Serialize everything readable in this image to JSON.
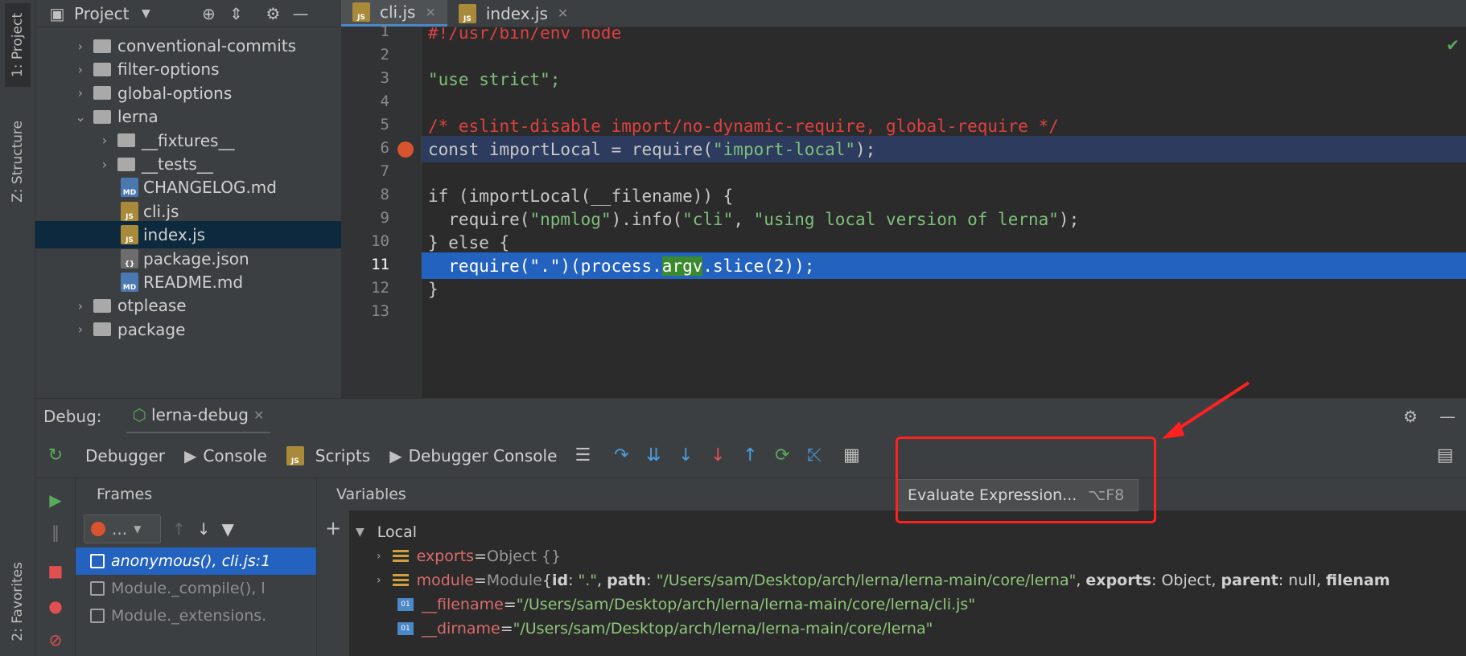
{
  "left_strip": {
    "project_tab": "1: Project",
    "structure_tab": "Z: Structure",
    "favorites_tab": "2: Favorites"
  },
  "project_panel": {
    "title": "Project",
    "tree": [
      {
        "label": "conventional-commits",
        "type": "folder",
        "expanded": false,
        "indent": 1
      },
      {
        "label": "filter-options",
        "type": "folder",
        "expanded": false,
        "indent": 1
      },
      {
        "label": "global-options",
        "type": "folder",
        "expanded": false,
        "indent": 1
      },
      {
        "label": "lerna",
        "type": "folder",
        "expanded": true,
        "indent": 1
      },
      {
        "label": "__fixtures__",
        "type": "folder",
        "expanded": false,
        "indent": 2
      },
      {
        "label": "__tests__",
        "type": "folder",
        "expanded": false,
        "indent": 2
      },
      {
        "label": "CHANGELOG.md",
        "type": "md",
        "indent": 2
      },
      {
        "label": "cli.js",
        "type": "js",
        "indent": 2
      },
      {
        "label": "index.js",
        "type": "js",
        "indent": 2,
        "selected": true
      },
      {
        "label": "package.json",
        "type": "json",
        "indent": 2
      },
      {
        "label": "README.md",
        "type": "md",
        "indent": 2
      },
      {
        "label": "otplease",
        "type": "folder",
        "expanded": false,
        "indent": 1
      },
      {
        "label": "package",
        "type": "folder",
        "expanded": false,
        "indent": 1
      }
    ]
  },
  "editor": {
    "tabs": [
      {
        "label": "cli.js",
        "active": true
      },
      {
        "label": "index.js",
        "active": false
      }
    ],
    "line_numbers": [
      "1",
      "2",
      "3",
      "4",
      "5",
      "6",
      "7",
      "8",
      "9",
      "10",
      "11",
      "12",
      "13"
    ],
    "lines": {
      "l1": "#!/usr/bin/env node",
      "l3": "\"use strict\";",
      "l5": "/* eslint-disable import/no-dynamic-require, global-require */",
      "l6_a": "const importLocal = require(",
      "l6_b": "\"import-local\"",
      "l6_c": ");",
      "l8": "if (importLocal(__filename)) {",
      "l9_a": "  require(",
      "l9_b": "\"npmlog\"",
      "l9_c": ").info(",
      "l9_d": "\"cli\"",
      "l9_e": ", ",
      "l9_f": "\"using local version of lerna\"",
      "l9_g": ");",
      "l10": "} else {",
      "l11_a": "  require(\".\")(process.",
      "l11_b": "argv",
      "l11_c": ".slice(2));",
      "l12": "}"
    }
  },
  "debug": {
    "label": "Debug:",
    "config": "lerna-debug",
    "tabs": {
      "debugger": "Debugger",
      "console": "Console",
      "scripts": "Scripts",
      "debugger_console": "Debugger Console"
    },
    "frames_header": "Frames",
    "variables_header": "Variables",
    "thread_selector": "...",
    "frames": [
      {
        "label": "anonymous(), cli.js:1",
        "selected": true
      },
      {
        "label": "Module._compile(), l",
        "selected": false
      },
      {
        "label": "Module._extensions.",
        "selected": false
      }
    ],
    "variables": {
      "local_label": "Local",
      "exports_name": "exports",
      "exports_eq": " = ",
      "exports_val": "Object {}",
      "module_name": "module",
      "module_eq": " = ",
      "module_type": "Module ",
      "module_brace": "{",
      "module_id_key": "id",
      "module_id_val": "\".\"",
      "module_path_key": "path",
      "module_path_val": "\"/Users/sam/Desktop/arch/lerna/lerna-main/core/lerna\"",
      "module_exports_key": "exports",
      "module_exports_val": "Object",
      "module_parent_key": "parent",
      "module_parent_val": "null",
      "module_tail": "filenam",
      "filename_name": "__filename",
      "filename_eq": " = ",
      "filename_val": "\"/Users/sam/Desktop/arch/lerna/lerna-main/core/lerna/cli.js\"",
      "dirname_name": "__dirname",
      "dirname_eq": " = ",
      "dirname_val": "\"/Users/sam/Desktop/arch/lerna/lerna-main/core/lerna\""
    },
    "tooltip": {
      "label": "Evaluate Expression...",
      "shortcut": "⌥F8"
    }
  },
  "colors": {
    "selection": "#2462c0",
    "annotation": "#ff2020",
    "breakpoint": "#d9532f"
  }
}
